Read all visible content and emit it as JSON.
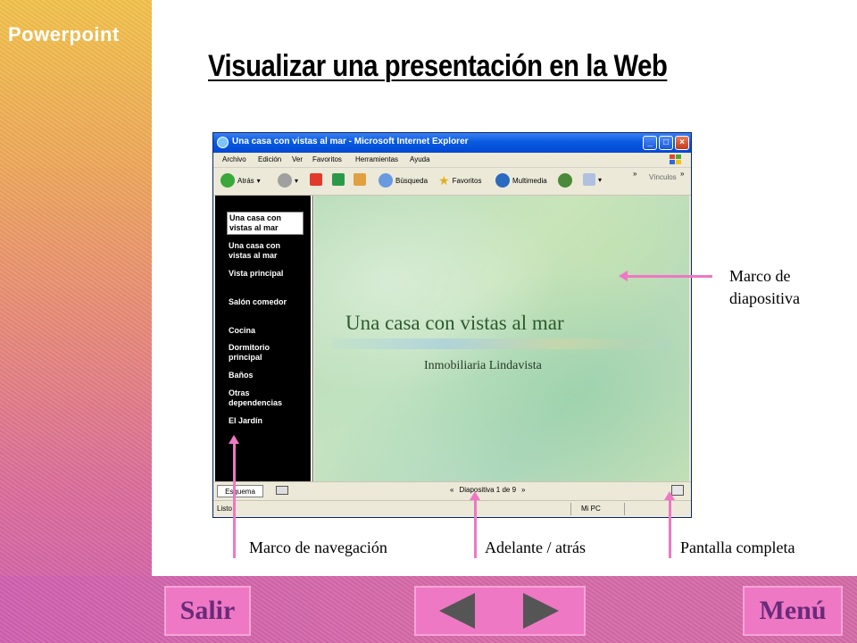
{
  "brand": "Powerpoint",
  "slide_title": "Visualizar una presentación en la Web",
  "browser": {
    "window_title": "Una casa con vistas al mar - Microsoft Internet Explorer",
    "menu": [
      "Archivo",
      "Edición",
      "Ver",
      "Favoritos",
      "Herramientas",
      "Ayuda"
    ],
    "toolbar": {
      "back": "Atrás",
      "search": "Búsqueda",
      "favorites": "Favoritos",
      "multimedia": "Multimedia",
      "chevron": "»",
      "links": "Vínculos"
    },
    "outline_items": [
      "Una casa con vistas al mar",
      "Una casa con vistas al mar",
      "Vista principal",
      "Salón comedor",
      "Cocina",
      "Dormitorio principal",
      "Baños",
      "Otras dependencias",
      "El Jardín"
    ],
    "slide": {
      "title": "Una casa con vistas al mar",
      "subtitle": "Inmobiliaria Lindavista"
    },
    "bottom": {
      "tab": "Esquema",
      "prev": "«",
      "slide_counter": "Diapositiva 1 de 9",
      "next": "»"
    },
    "status": {
      "text": "Listo",
      "zone": "Mi PC"
    }
  },
  "callouts": {
    "slide_frame": "Marco de diapositiva",
    "slide_frame_l1": "Marco de",
    "slide_frame_l2": "diapositiva",
    "nav_frame": "Marco de navegación",
    "forward_back": "Adelante / atrás",
    "fullscreen": "Pantalla completa"
  },
  "buttons": {
    "exit": "Salir",
    "menu": "Menú"
  },
  "colors": {
    "accent_pink": "#ee78c4",
    "button_text": "#6a2a7a",
    "xp_title_blue": "#0a5ae0"
  }
}
